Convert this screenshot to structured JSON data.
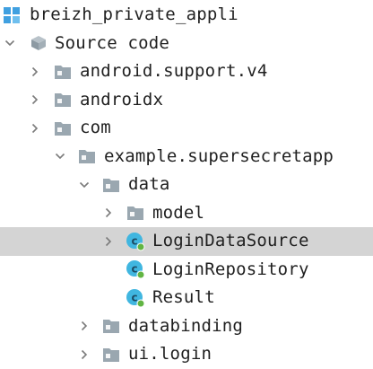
{
  "tree": {
    "project": {
      "label": "breizh_private_appli",
      "icon": "project-module-icon"
    },
    "source_code": {
      "label": "Source code",
      "icon": "source-root-icon",
      "expanded": true
    },
    "items": [
      {
        "label": "android.support.v4",
        "icon": "package-folder-icon",
        "expanded": false
      },
      {
        "label": "androidx",
        "icon": "package-folder-icon",
        "expanded": false
      },
      {
        "label": "com",
        "icon": "package-folder-icon",
        "expanded": true
      },
      {
        "label": "example.supersecretapp",
        "icon": "package-folder-icon",
        "expanded": true
      },
      {
        "label": "data",
        "icon": "package-folder-icon",
        "expanded": true
      },
      {
        "label": "model",
        "icon": "package-folder-icon",
        "expanded": false
      },
      {
        "label": "LoginDataSource",
        "icon": "class-icon",
        "selected": true
      },
      {
        "label": "LoginRepository",
        "icon": "class-icon"
      },
      {
        "label": "Result",
        "icon": "class-icon"
      },
      {
        "label": "databinding",
        "icon": "package-folder-icon",
        "expanded": false
      },
      {
        "label": "ui.login",
        "icon": "package-folder-icon",
        "expanded": false
      }
    ]
  },
  "colors": {
    "selection": "#d4d4d4",
    "folder": "#9aa7b0",
    "project_icon": "#40a0e0",
    "class_icon": "#40b6e0",
    "class_badge": "#62b543",
    "chevron": "#7b7b7b"
  }
}
